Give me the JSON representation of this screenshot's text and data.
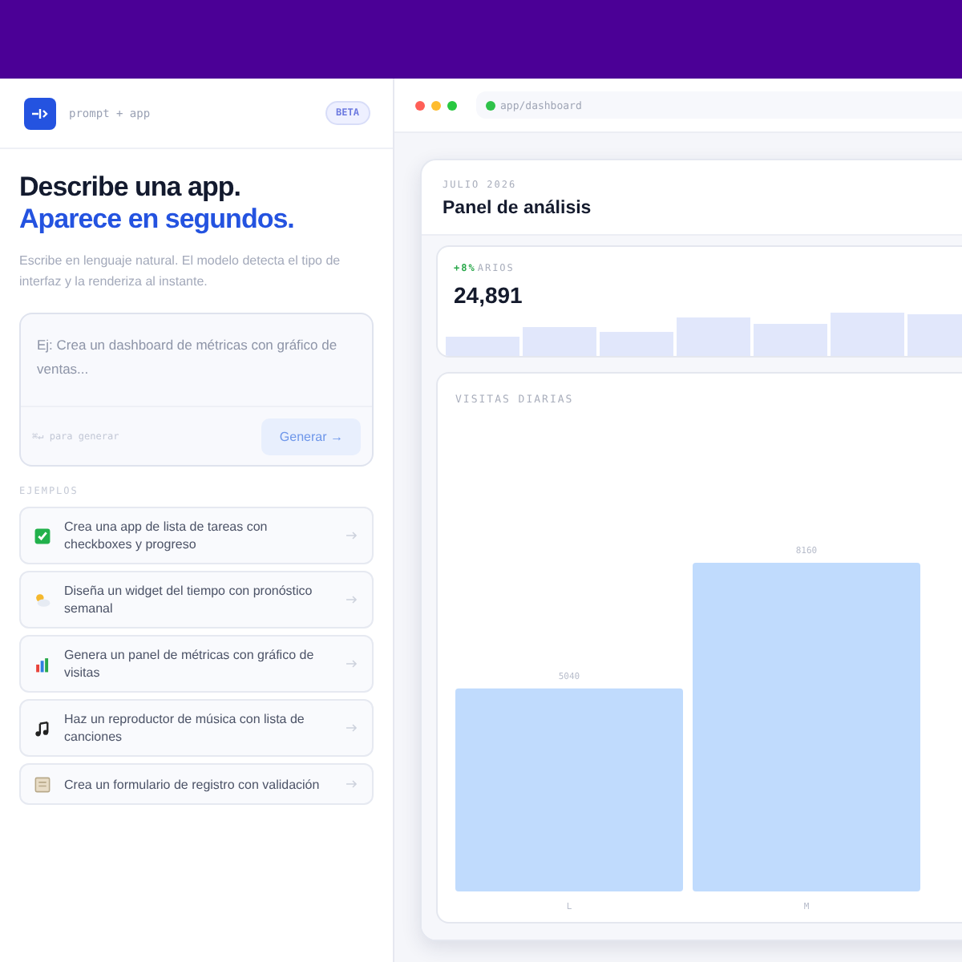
{
  "brand": {
    "name": "prompt + app",
    "badge": "BETA"
  },
  "hero": {
    "title": "Describe una app.",
    "title_accent": "Aparece en segundos.",
    "description": "Escribe en lenguaje natural. El modelo detecta el tipo de interfaz y la renderiza al instante."
  },
  "prompt": {
    "placeholder": "Ej: Crea un dashboard de métricas con gráfico de ventas...",
    "hint": "⌘↵ para generar",
    "button": "Generar →"
  },
  "examples": {
    "label": "EJEMPLOS",
    "items": [
      {
        "kind": "check",
        "text": "Crea una app de lista de tareas con checkboxes y progreso"
      },
      {
        "kind": "weather",
        "text": "Diseña un widget del tiempo con pronóstico semanal"
      },
      {
        "kind": "chart",
        "text": "Genera un panel de métricas con gráfico de visitas"
      },
      {
        "kind": "music",
        "text": "Haz un reproductor de música con lista de canciones"
      },
      {
        "kind": "form",
        "text": "Crea un formulario de registro con validación"
      }
    ]
  },
  "browser": {
    "url": "app/dashboard"
  },
  "dashboard": {
    "eyebrow": "JULIO 2026",
    "title": "Panel de análisis",
    "stat": {
      "delta": "+8%",
      "label": "ARIOS",
      "value": "24,891"
    },
    "chart": {
      "title": "VISITAS DIARIAS",
      "chart_data": {
        "type": "bar",
        "categories": [
          "L",
          "M"
        ],
        "values": [
          5040,
          8160
        ],
        "data_labels": true
      }
    }
  }
}
